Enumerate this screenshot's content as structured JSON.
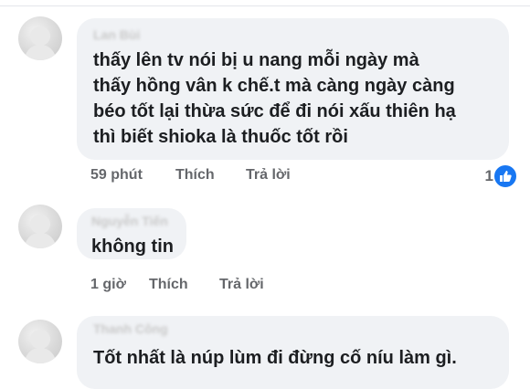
{
  "comments": [
    {
      "author": "Lan Bùi",
      "text": "thấy lên tv nói bị u nang mỗi ngày mà\nthấy hồng vân k chế.t mà càng ngày càng\nbéo tốt lại thừa sức để đi nói xấu thiên hạ\nthì biết shioka là thuốc tốt rồi",
      "time": "59 phút",
      "like_label": "Thích",
      "reply_label": "Trả lời",
      "reaction_count": "1",
      "reaction_icon": "like-icon"
    },
    {
      "author": "Nguyễn Tiến",
      "text": "không tin",
      "time": "1 giờ",
      "like_label": "Thích",
      "reply_label": "Trả lời"
    },
    {
      "author": "Thanh Công",
      "text": "Tốt nhất là núp lùm đi đừng cố níu làm gì."
    }
  ],
  "colors": {
    "bubble": "#f0f2f5",
    "text": "#1c1e21",
    "meta": "#65676b",
    "like_blue": "#1877f2"
  }
}
